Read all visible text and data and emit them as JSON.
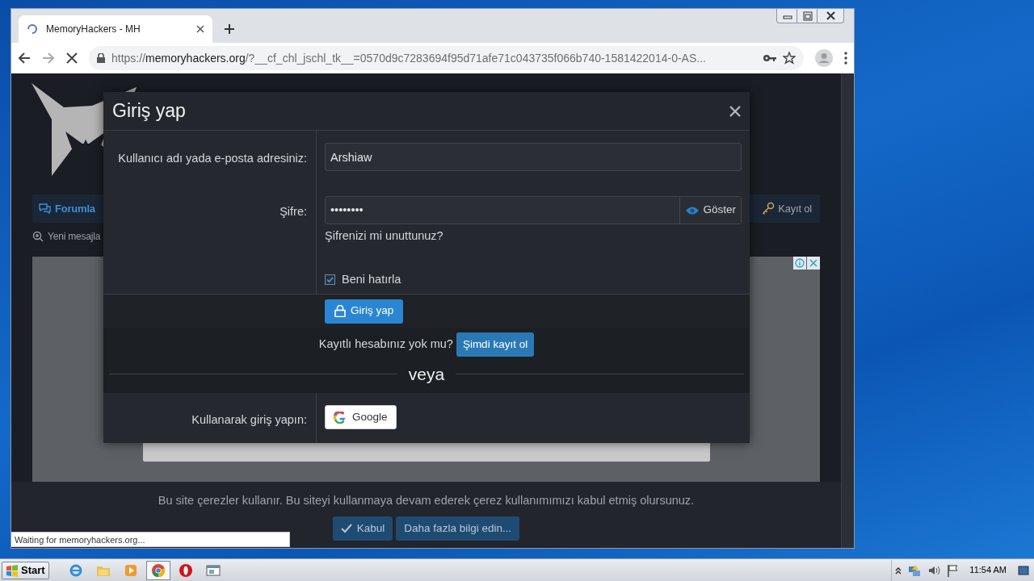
{
  "browser": {
    "tab": {
      "title": "MemoryHackers - MH",
      "loading": true
    },
    "url": {
      "scheme": "https://",
      "host": "memoryhackers.org",
      "path": "/?__cf_chl_jschl_tk__=0570d9c7283694f95d71afe71c043735f066b740-1581422014-0-AS..."
    },
    "status": "Waiting for memoryhackers.org..."
  },
  "page": {
    "nav_items": [
      {
        "label": "Forumla",
        "selected": true,
        "kind": "forums"
      },
      {
        "label": "Kayıt ol",
        "selected": false,
        "kind": "register"
      }
    ],
    "sub_link": "Yeni mesajla",
    "cookie": {
      "text": "Bu site çerezler kullanır. Bu siteyi kullanmaya devam ederek çerez kullanımımızı kabul etmiş olursunuz.",
      "buttons": [
        {
          "label": "Kabul",
          "kind": "accept"
        },
        {
          "label": "Daha fazla bilgi edin...",
          "kind": "more"
        }
      ]
    }
  },
  "modal": {
    "title": "Giriş yap",
    "username": {
      "label": "Kullanıcı adı yada e-posta adresiniz:",
      "value": "Arshiaw"
    },
    "password": {
      "label": "Şifre:",
      "value": "••••••••",
      "show_button": "Göster",
      "forgot_link": "Şifrenizi mi unuttunuz?"
    },
    "remember": {
      "label": "Beni hatırla",
      "checked": true
    },
    "submit": "Giriş yap",
    "register_prompt": "Kayıtlı hesabınız yok mu?",
    "register_button": "Şimdi kayıt ol",
    "divider": "veya",
    "social_label": "Kullanarak giriş yapın:",
    "social_button": "Google"
  },
  "taskbar": {
    "start": "Start",
    "clock": "11:54 AM",
    "apps": [
      {
        "kind": "ie",
        "selected": false
      },
      {
        "kind": "folder",
        "selected": false
      },
      {
        "kind": "media",
        "selected": false
      },
      {
        "kind": "chrome",
        "selected": true
      },
      {
        "kind": "opera",
        "selected": false
      },
      {
        "kind": "window",
        "selected": false
      }
    ]
  }
}
